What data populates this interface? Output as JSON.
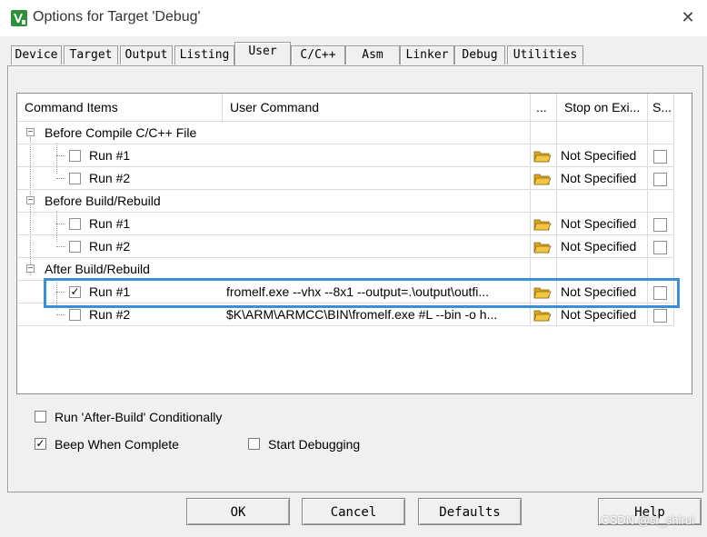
{
  "window": {
    "title": "Options for Target 'Debug'",
    "close_glyph": "✕"
  },
  "tabs": [
    {
      "label": "Device",
      "active": false
    },
    {
      "label": "Target",
      "active": false
    },
    {
      "label": "Output",
      "active": false
    },
    {
      "label": "Listing",
      "active": false
    },
    {
      "label": "User",
      "active": true
    },
    {
      "label": "C/C++",
      "active": false
    },
    {
      "label": "Asm",
      "active": false
    },
    {
      "label": "Linker",
      "active": false
    },
    {
      "label": "Debug",
      "active": false
    },
    {
      "label": "Utilities",
      "active": false
    }
  ],
  "grid": {
    "headers": {
      "command_items": "Command Items",
      "user_command": "User Command",
      "browse": "...",
      "stop_on_exit": "Stop on Exi...",
      "s": "S..."
    },
    "groups": [
      {
        "title": "Before Compile C/C++ File",
        "expander": "−",
        "runs": [
          {
            "label": "Run #1",
            "checked": false,
            "command": "",
            "stop": "Not Specified"
          },
          {
            "label": "Run #2",
            "checked": false,
            "command": "",
            "stop": "Not Specified"
          }
        ]
      },
      {
        "title": "Before Build/Rebuild",
        "expander": "−",
        "runs": [
          {
            "label": "Run #1",
            "checked": false,
            "command": "",
            "stop": "Not Specified"
          },
          {
            "label": "Run #2",
            "checked": false,
            "command": "",
            "stop": "Not Specified"
          }
        ]
      },
      {
        "title": "After Build/Rebuild",
        "expander": "−",
        "runs": [
          {
            "label": "Run #1",
            "checked": true,
            "command": "fromelf.exe --vhx --8x1 --output=.\\output\\outfi...",
            "stop": "Not Specified"
          },
          {
            "label": "Run #2",
            "checked": false,
            "command": "$K\\ARM\\ARMCC\\BIN\\fromelf.exe #L --bin -o h...",
            "stop": "Not Specified"
          }
        ]
      }
    ]
  },
  "options": {
    "run_after_build": {
      "label": "Run 'After-Build' Conditionally",
      "checked": false
    },
    "beep_when_complete": {
      "label": "Beep When Complete",
      "checked": true
    },
    "start_debugging": {
      "label": "Start Debugging",
      "checked": false
    }
  },
  "buttons": {
    "ok": "OK",
    "cancel": "Cancel",
    "defaults": "Defaults",
    "help": "Help"
  },
  "watermark": "CSDN @sr_shirui",
  "colors": {
    "highlight_border": "#3a8fd6",
    "folder_fill": "#f4c542"
  }
}
